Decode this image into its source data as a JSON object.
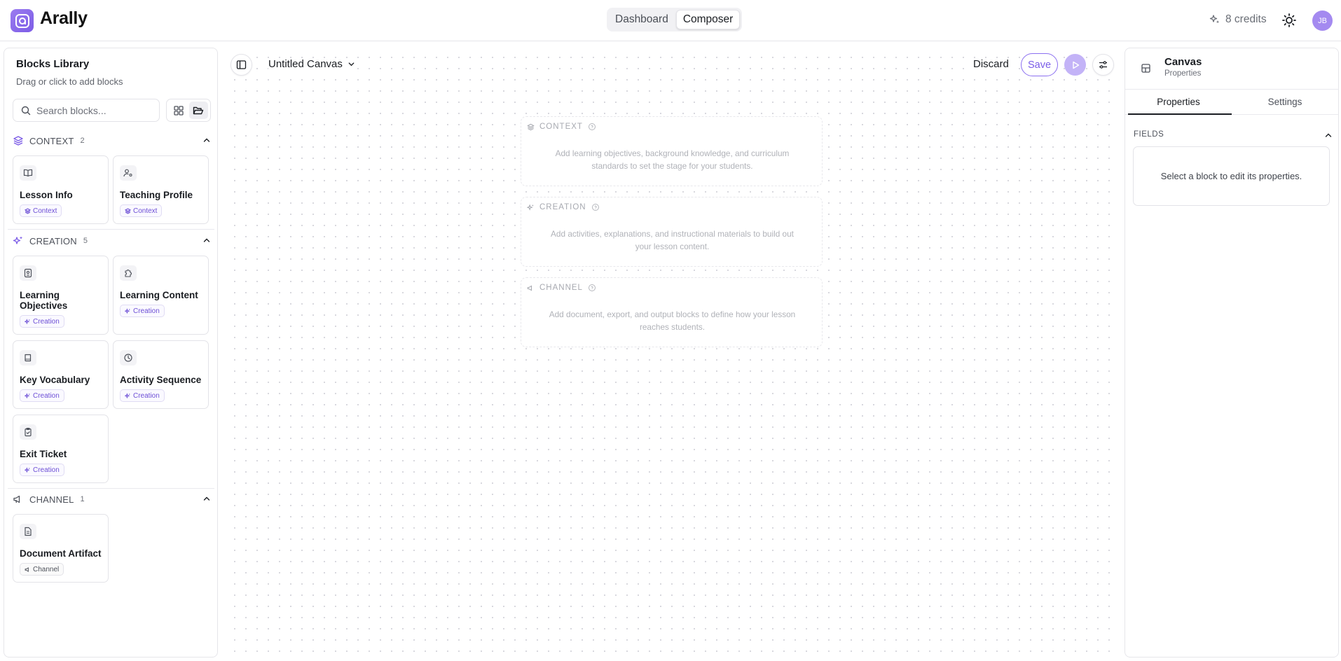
{
  "app": {
    "name": "Arally"
  },
  "nav": {
    "tabs": [
      {
        "label": "Dashboard"
      },
      {
        "label": "Composer"
      }
    ],
    "active": "Composer"
  },
  "header": {
    "credits": "8 credits",
    "avatar_initials": "JB"
  },
  "library": {
    "title": "Blocks Library",
    "subtitle": "Drag or click to add blocks",
    "search_placeholder": "Search blocks...",
    "sections": [
      {
        "name": "CONTEXT",
        "count": "2",
        "blocks": [
          {
            "title": "Lesson Info",
            "tag": "Context",
            "icon": "book-icon"
          },
          {
            "title": "Teaching Profile",
            "tag": "Context",
            "icon": "user-cog-icon"
          }
        ]
      },
      {
        "name": "CREATION",
        "count": "5",
        "blocks": [
          {
            "title": "Learning Objectives",
            "tag": "Creation",
            "icon": "target-doc-icon"
          },
          {
            "title": "Learning Content",
            "tag": "Creation",
            "icon": "puzzle-icon"
          },
          {
            "title": "Key Vocabulary",
            "tag": "Creation",
            "icon": "book-closed-icon"
          },
          {
            "title": "Activity Sequence",
            "tag": "Creation",
            "icon": "clock-icon"
          },
          {
            "title": "Exit Ticket",
            "tag": "Creation",
            "icon": "clipboard-check-icon"
          }
        ]
      },
      {
        "name": "CHANNEL",
        "count": "1",
        "blocks": [
          {
            "title": "Document Artifact",
            "tag": "Channel",
            "icon": "file-text-icon"
          }
        ]
      }
    ]
  },
  "canvas": {
    "name": "Untitled Canvas",
    "discard_label": "Discard",
    "save_label": "Save",
    "zones": [
      {
        "name": "CONTEXT",
        "description": "Add learning objectives, background knowledge, and curriculum standards to set the stage for your students."
      },
      {
        "name": "CREATION",
        "description": "Add activities, explanations, and instructional materials to build out your lesson content."
      },
      {
        "name": "CHANNEL",
        "description": "Add document, export, and output blocks to define how your lesson reaches students."
      }
    ]
  },
  "panel": {
    "title": "Canvas",
    "subtitle": "Properties",
    "tabs": [
      {
        "label": "Properties"
      },
      {
        "label": "Settings"
      }
    ],
    "fields_heading": "FIELDS",
    "empty_message": "Select a block to edit its properties."
  },
  "colors": {
    "accent": "#7c5ce6",
    "accent_light": "#c3b3f7",
    "tag_text": "#6d4fd6"
  }
}
